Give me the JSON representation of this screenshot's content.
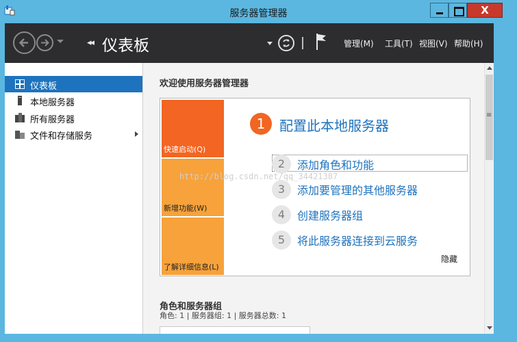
{
  "window": {
    "title": "服务器管理器",
    "controls": {
      "close_label": "X"
    }
  },
  "toolbar": {
    "breadcrumb_arrows": "◂◂",
    "page_title": "仪表板",
    "menus": [
      "管理(M)",
      "工具(T)",
      "视图(V)",
      "帮助(H)"
    ]
  },
  "sidebar": {
    "items": [
      {
        "label": "仪表板",
        "icon": "dashboard-icon",
        "active": true
      },
      {
        "label": "本地服务器",
        "icon": "server-icon",
        "active": false
      },
      {
        "label": "所有服务器",
        "icon": "servers-icon",
        "active": false
      },
      {
        "label": "文件和存储服务",
        "icon": "storage-icon",
        "active": false,
        "has_children": true
      }
    ]
  },
  "welcome": {
    "heading": "欢迎使用服务器管理器",
    "tiles": [
      "快速启动(Q)",
      "新增功能(W)",
      "了解详细信息(L)"
    ],
    "step1": {
      "number": "1",
      "label": "配置此本地服务器"
    },
    "steps": [
      {
        "number": "2",
        "label": "添加角色和功能"
      },
      {
        "number": "3",
        "label": "添加要管理的其他服务器"
      },
      {
        "number": "4",
        "label": "创建服务器组"
      },
      {
        "number": "5",
        "label": "将此服务器连接到云服务"
      }
    ],
    "hide_label": "隐藏",
    "watermark": "http://blog.csdn.net/qq_34421387"
  },
  "roles": {
    "heading": "角色和服务器组",
    "summary": "角色: 1 | 服务器组: 1 | 服务器总数: 1"
  },
  "colors": {
    "accent": "#1e73be",
    "titlebar": "#5bb7e0",
    "toolbar": "#2d2d30",
    "quick_start": "#f26522",
    "tile": "#f7a23b",
    "close": "#c7392b"
  }
}
